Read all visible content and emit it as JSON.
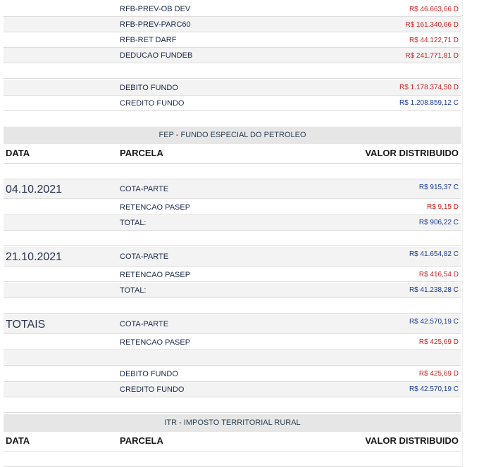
{
  "top_rows": [
    {
      "label": "RFB-PREV-OB DEV",
      "value": "R$ 46.663,66 D"
    },
    {
      "label": "RFB-PREV-PARC60",
      "value": "R$ 161.340,66 D"
    },
    {
      "label": "RFB-RET DARF",
      "value": "R$ 44.122,71 D"
    },
    {
      "label": "DEDUCAO FUNDEB",
      "value": "R$ 241.771,81 D"
    }
  ],
  "top_totals": [
    {
      "label": "DEBITO FUNDO",
      "value": "R$ 1.178.374,50 D"
    },
    {
      "label": "CREDITO FUNDO",
      "value": "R$ 1.208.859,12 C"
    }
  ],
  "fep": {
    "title": "FEP - FUNDO ESPECIAL DO PETROLEO",
    "headers": {
      "data": "DATA",
      "parcela": "PARCELA",
      "valor": "VALOR DISTRIBUIDO"
    },
    "groups": [
      {
        "date": "04.10.2021",
        "rows": [
          {
            "label": "COTA-PARTE",
            "value": "R$ 915,37 C"
          },
          {
            "label": "RETENCAO PASEP",
            "value": "R$ 9,15 D"
          },
          {
            "label": "TOTAL:",
            "value": "R$ 906,22 C"
          }
        ]
      },
      {
        "date": "21.10.2021",
        "rows": [
          {
            "label": "COTA-PARTE",
            "value": "R$ 41.654,82 C"
          },
          {
            "label": "RETENCAO PASEP",
            "value": "R$ 416,54 D"
          },
          {
            "label": "TOTAL:",
            "value": "R$ 41.238,28 C"
          }
        ]
      },
      {
        "date": "TOTAIS",
        "rows": [
          {
            "label": "COTA-PARTE",
            "value": "R$ 42.570,19 C"
          },
          {
            "label": "RETENCAO PASEP",
            "value": "R$ 425,69 D"
          }
        ]
      }
    ],
    "totals": [
      {
        "label": "DEBITO FUNDO",
        "value": "R$ 425,69 D"
      },
      {
        "label": "CREDITO FUNDO",
        "value": "R$ 42.570,19 C"
      }
    ]
  },
  "itr": {
    "title": "ITR - IMPOSTO TERRITORIAL RURAL",
    "headers": {
      "data": "DATA",
      "parcela": "PARCELA",
      "valor": "VALOR DISTRIBUIDO"
    }
  },
  "colors": {
    "debit": "#cc2222",
    "credit": "#1a3a9a",
    "section_bg": "#e6e6e6",
    "row_alt": "#f3f3f3"
  }
}
